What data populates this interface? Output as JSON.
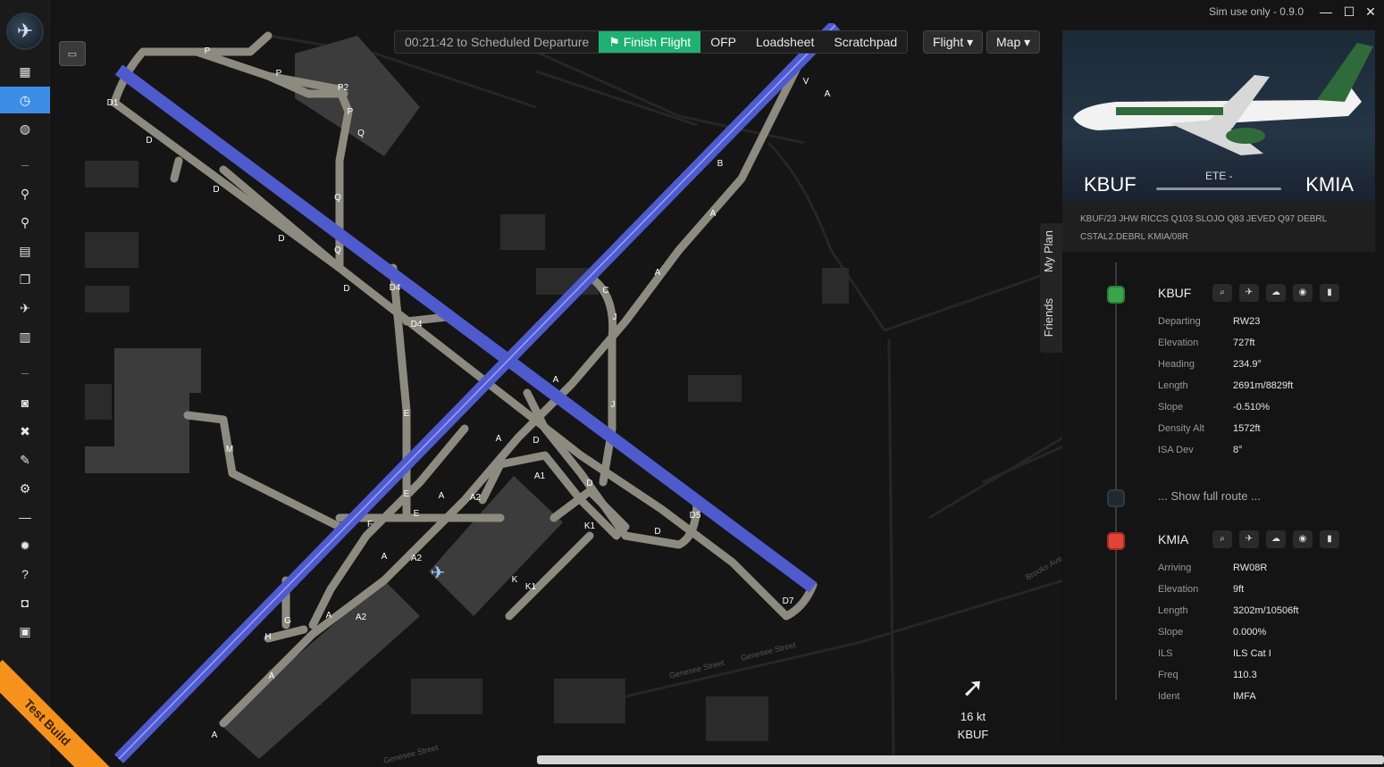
{
  "titlebar": {
    "text": "Sim use only - 0.9.0",
    "minimize": "—",
    "maximize": "☐",
    "close": "✕"
  },
  "sidebar": {
    "logo": "✈",
    "items": [
      {
        "icon": "dashboard-icon",
        "glyph": "▦",
        "active": false
      },
      {
        "icon": "clock-icon",
        "glyph": "◷",
        "active": true
      },
      {
        "icon": "globe-icon",
        "glyph": "◍",
        "active": false
      },
      {
        "icon": "route-icon",
        "glyph": "⚲",
        "active": false
      },
      {
        "icon": "route-alt-icon",
        "glyph": "⚲",
        "active": false
      },
      {
        "icon": "calendar-icon",
        "glyph": "▤",
        "active": false
      },
      {
        "icon": "documents-icon",
        "glyph": "❐",
        "active": false
      },
      {
        "icon": "plane-icon",
        "glyph": "✈",
        "active": false
      },
      {
        "icon": "report-icon",
        "glyph": "▥",
        "active": false
      },
      {
        "icon": "camera-icon",
        "glyph": "◙",
        "active": false
      },
      {
        "icon": "tools-icon",
        "glyph": "✖",
        "active": false
      },
      {
        "icon": "plugin-icon",
        "glyph": "✎",
        "active": false
      },
      {
        "icon": "gear-icon",
        "glyph": "⚙",
        "active": false
      },
      {
        "icon": "minus-icon",
        "glyph": "—",
        "active": false
      },
      {
        "icon": "bug-icon",
        "glyph": "✹",
        "active": false
      },
      {
        "icon": "help-icon",
        "glyph": "?",
        "active": false
      },
      {
        "icon": "discord-icon",
        "glyph": "◘",
        "active": false
      },
      {
        "icon": "gift-icon",
        "glyph": "▣",
        "active": false
      }
    ],
    "test_build": "Test Build"
  },
  "toolbar": {
    "timer": "00:21:42 to Scheduled Departure",
    "finish": "Finish Flight",
    "ofp": "OFP",
    "loadsheet": "Loadsheet",
    "scratchpad": "Scratchpad",
    "flight": "Flight ▾",
    "map": "Map ▾"
  },
  "map": {
    "taxiway_labels": [
      "P",
      "P",
      "P2",
      "P",
      "Q",
      "Q",
      "D1",
      "D",
      "D",
      "D",
      "D",
      "Q",
      "D4",
      "D4",
      "E",
      "E",
      "E",
      "F",
      "M",
      "G",
      "H",
      "A",
      "A",
      "A",
      "A",
      "A2",
      "A2",
      "A2",
      "A",
      "A",
      "B",
      "A",
      "A",
      "C",
      "J",
      "J",
      "D",
      "D",
      "D5",
      "D",
      "D7",
      "A1",
      "K1",
      "K",
      "K1",
      "V",
      "A",
      "A"
    ],
    "road_labels": [
      "Genesee Street",
      "Genesee Street",
      "Genesee Street",
      "Brooks Ave"
    ],
    "wind": {
      "arrow": "➚",
      "speed": "16 kt",
      "airport": "KBUF"
    }
  },
  "flight": {
    "from": "KBUF",
    "to": "KMIA",
    "ete": "ETE -",
    "route": "KBUF/23 JHW RICCS Q103 SLOJO Q83 JEVED Q97 DEBRL CSTAL2.DEBRL KMIA/08R",
    "tabs": [
      "My Plan",
      "Friends"
    ],
    "departure": {
      "code": "KBUF",
      "color": "#3aa44a",
      "rows": [
        {
          "k": "Departing",
          "v": "RW23"
        },
        {
          "k": "Elevation",
          "v": "727ft"
        },
        {
          "k": "Heading",
          "v": "234.9°"
        },
        {
          "k": "Length",
          "v": "2691m/8829ft"
        },
        {
          "k": "Slope",
          "v": "-0.510%"
        },
        {
          "k": "Density Alt",
          "v": "1572ft"
        },
        {
          "k": "ISA Dev",
          "v": "8°"
        }
      ]
    },
    "show_full": "... Show full route ...",
    "arrival": {
      "code": "KMIA",
      "color": "#e0433a",
      "rows": [
        {
          "k": "Arriving",
          "v": "RW08R"
        },
        {
          "k": "Elevation",
          "v": "9ft"
        },
        {
          "k": "Length",
          "v": "3202m/10506ft"
        },
        {
          "k": "Slope",
          "v": "0.000%"
        },
        {
          "k": "ILS",
          "v": "ILS Cat I"
        },
        {
          "k": "Freq",
          "v": "110.3"
        },
        {
          "k": "Ident",
          "v": "IMFA"
        }
      ]
    },
    "airport_buttons": [
      "search-icon",
      "takeoff-icon",
      "weather-icon",
      "radar-icon",
      "clipboard-icon"
    ]
  },
  "colors": {
    "runway": "#4f5bcd",
    "taxiway": "#8d8b80",
    "accent": "#3b8de6",
    "finish": "#1fb173"
  }
}
